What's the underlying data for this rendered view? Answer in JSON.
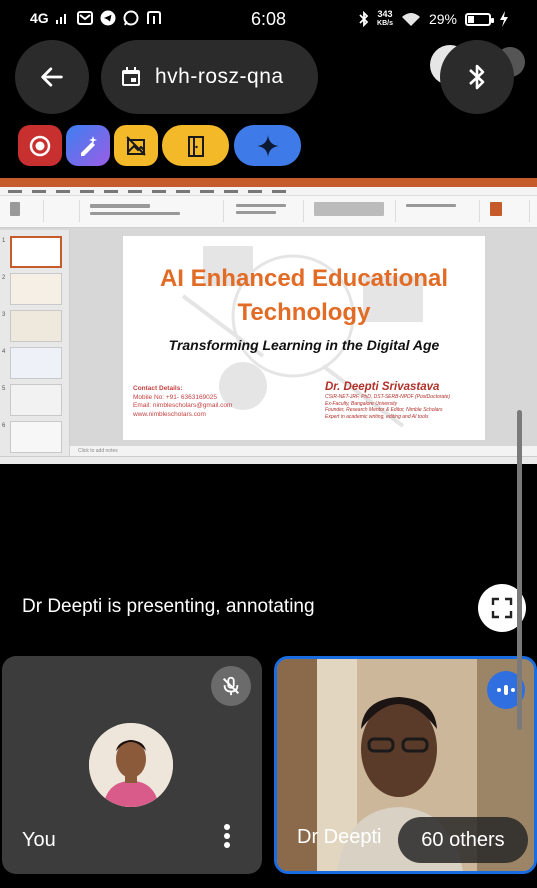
{
  "status_bar": {
    "network": "4G",
    "time": "6:08",
    "net_speed_value": "343",
    "net_speed_unit": "KB/s",
    "battery_percent": "29%",
    "battery_level": 0.29
  },
  "top_bar": {
    "meeting_code": "hvh-rosz-qna"
  },
  "slide": {
    "title_line1": "AI Enhanced Educational",
    "title_line2": "Technology",
    "subtitle": "Transforming Learning in the Digital Age",
    "contact_heading": "Contact Details:",
    "contact_mobile": "Mobile No: +91- 6363169025",
    "contact_email": "Email: nimblescholars@gmail.com",
    "contact_web": "www.nimblescholars.com",
    "author_name": "Dr. Deepti Srivastava",
    "author_line1": "CSIR-NET-JRF, PhD, DST-SERB-NPDF (PostDoctorate)",
    "author_line2": "Ex-Faculty, Bangalore University",
    "author_line3": "Founder, Research Mentor & Editor, Nimble Scholars",
    "author_line4": "Expert in academic writing, editing and AI tools",
    "notes_placeholder": "Click to add notes"
  },
  "presenting_text": "Dr Deepti is presenting, annotating",
  "tiles": {
    "self_label": "You",
    "speaker_label": "Dr Deepti",
    "others_label": "60 others"
  },
  "colors": {
    "accent_blue": "#1a6de0",
    "slide_title_orange": "#e26b25",
    "chip_red": "#c8302f",
    "chip_yellow": "#f3b928",
    "chip_blue": "#3f7be8"
  },
  "icons": {
    "back": "arrow-left-icon",
    "calendar": "calendar-icon",
    "bluetooth": "bluetooth-icon",
    "record": "record-icon",
    "annotate": "pen-sparkle-icon",
    "no_background": "crossed-image-icon",
    "door": "door-icon",
    "gemini": "sparkle-icon",
    "fullscreen": "fullscreen-icon",
    "muted": "mic-off-icon",
    "more": "more-vertical-icon"
  }
}
